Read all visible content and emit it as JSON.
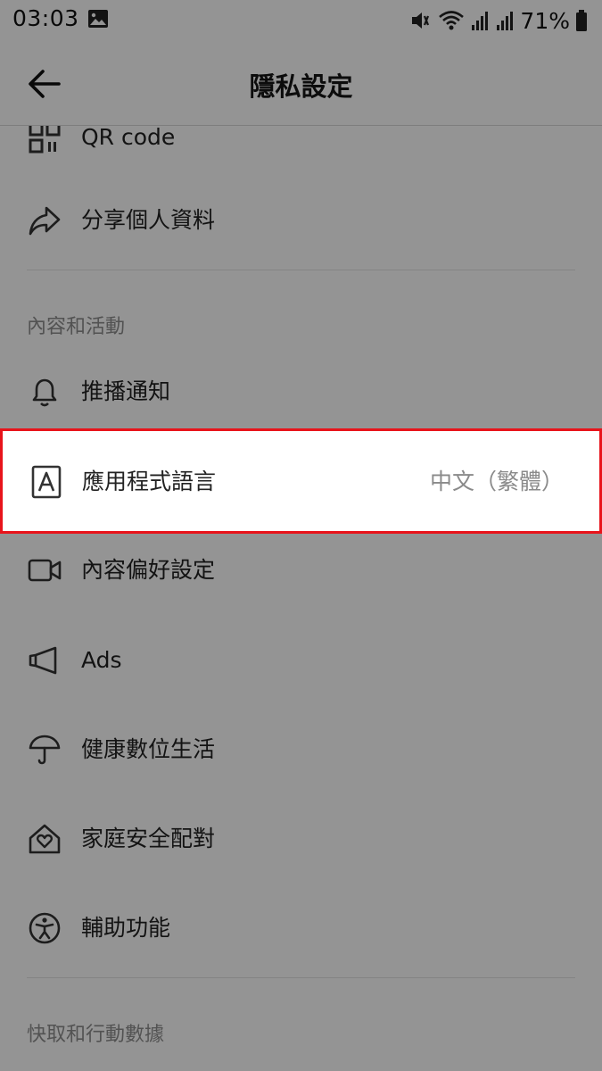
{
  "status_bar": {
    "time": "03:03",
    "battery": "71%",
    "icons": [
      "gallery-icon",
      "mute-vibrate-icon",
      "wifi-icon",
      "signal-icon",
      "signal-icon-2",
      "battery-icon"
    ]
  },
  "header": {
    "title": "隱私設定",
    "back_icon": "arrow-left-icon"
  },
  "rows": {
    "qr_code": {
      "label": "QR code",
      "icon": "qr-code-icon"
    },
    "share_profile": {
      "label": "分享個人資料",
      "icon": "share-icon"
    },
    "push_notifications": {
      "label": "推播通知",
      "icon": "bell-icon"
    },
    "app_language": {
      "label": "應用程式語言",
      "value": "中文（繁體）",
      "icon": "language-icon"
    },
    "content_preferences": {
      "label": "內容偏好設定",
      "icon": "video-camera-icon"
    },
    "ads": {
      "label": "Ads",
      "icon": "megaphone-icon"
    },
    "digital_wellbeing": {
      "label": "健康數位生活",
      "icon": "umbrella-icon"
    },
    "family_pairing": {
      "label": "家庭安全配對",
      "icon": "home-heart-icon"
    },
    "accessibility": {
      "label": "輔助功能",
      "icon": "accessibility-icon"
    }
  },
  "sections": {
    "content_activity": "內容和活動",
    "cache_data": "快取和行動數據"
  },
  "colors": {
    "highlight_border": "#e8141b",
    "dim_overlay": "rgba(0,0,0,0.42)"
  }
}
